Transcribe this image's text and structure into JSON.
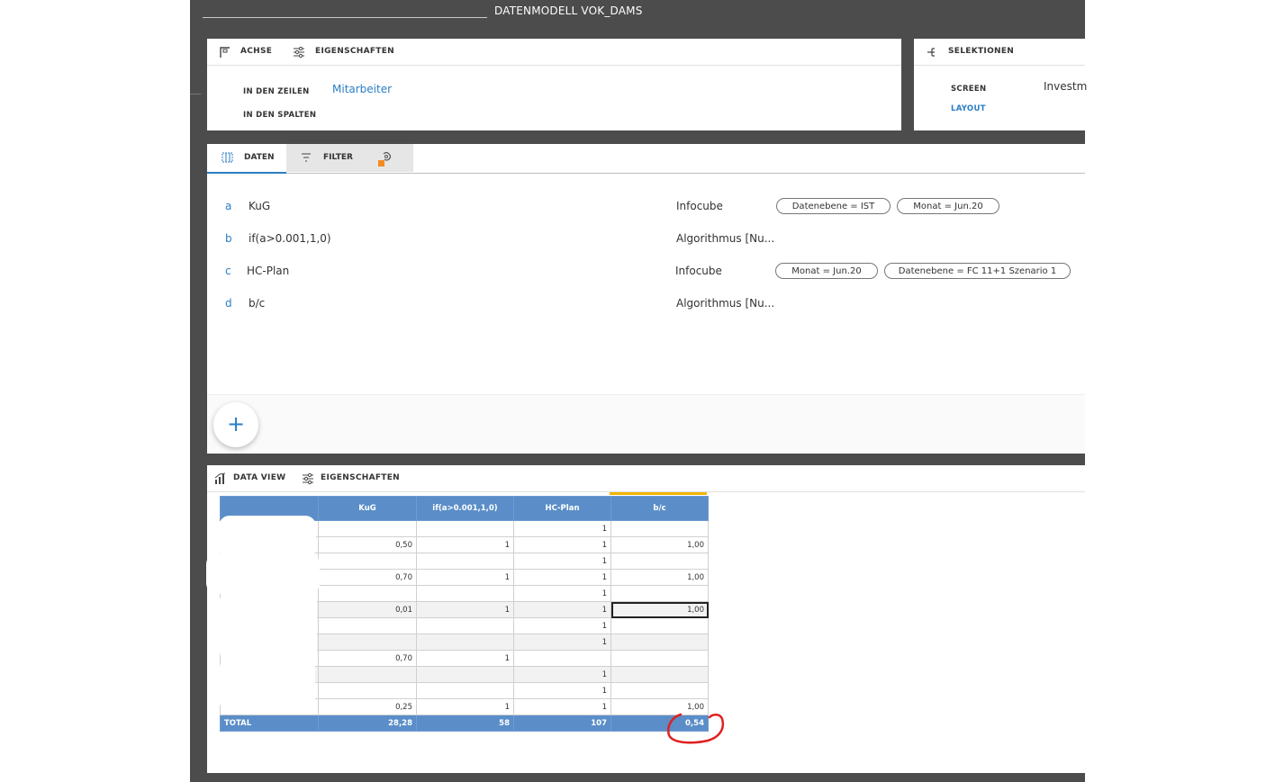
{
  "window": {
    "title": "DATENMODELL  VOK_DAMS"
  },
  "axis_panel": {
    "tab_axis": "ACHSE",
    "tab_properties": "EIGENSCHAFTEN",
    "rows_label": "IN DEN ZEILEN",
    "rows_value": "Mitarbeiter",
    "cols_label": "IN DEN SPALTEN"
  },
  "selection_panel": {
    "title": "SELEKTIONEN",
    "screen_label": "SCREEN",
    "screen_value": "Investm",
    "layout_link": "LAYOUT"
  },
  "data_tabs": {
    "daten": "DATEN",
    "filter": "FILTER"
  },
  "measures": [
    {
      "letter": "a",
      "name": "KuG",
      "source": "Infocube",
      "filters": [
        "Datenebene = IST",
        "Monat = Jun.20"
      ]
    },
    {
      "letter": "b",
      "name": "if(a>0.001,1,0)",
      "source": "Algorithmus [Nu...",
      "filters": []
    },
    {
      "letter": "c",
      "name": "HC-Plan",
      "source": "Infocube",
      "filters": [
        "Monat = Jun.20",
        "Datenebene = FC 11+1 Szenario 1"
      ]
    },
    {
      "letter": "d",
      "name": "b/c",
      "source": "Algorithmus [Nu...",
      "filters": []
    }
  ],
  "add_button": "+",
  "dataview_panel": {
    "tab_view": "DATA VIEW",
    "tab_properties": "EIGENSCHAFTEN"
  },
  "table": {
    "columns": [
      "",
      "KuG",
      "if(a>0.001,1,0)",
      "HC-Plan",
      "b/c"
    ],
    "rows": [
      [
        "",
        "",
        "",
        "1",
        ""
      ],
      [
        "",
        "0,50",
        "1",
        "1",
        "1,00"
      ],
      [
        "",
        "",
        "",
        "1",
        ""
      ],
      [
        "",
        "0,70",
        "1",
        "1",
        "1,00"
      ],
      [
        "",
        "",
        "",
        "1",
        ""
      ],
      [
        "",
        "0,01",
        "1",
        "1",
        "1,00"
      ],
      [
        "",
        "",
        "",
        "1",
        ""
      ],
      [
        "",
        "",
        "",
        "1",
        ""
      ],
      [
        "",
        "0,70",
        "1",
        "",
        ""
      ],
      [
        "",
        "",
        "",
        "1",
        ""
      ],
      [
        "",
        "",
        "",
        "1",
        ""
      ],
      [
        "",
        "0,25",
        "1",
        "1",
        "1,00"
      ]
    ],
    "total": [
      "TOTAL",
      "28,28",
      "58",
      "107",
      "0,54"
    ]
  },
  "colors": {
    "accent": "#2a7ec4",
    "header_blue": "#5b8ec8",
    "frame": "#4c4c4c",
    "highlight": "#f4b400",
    "annotation": "#e02020"
  }
}
